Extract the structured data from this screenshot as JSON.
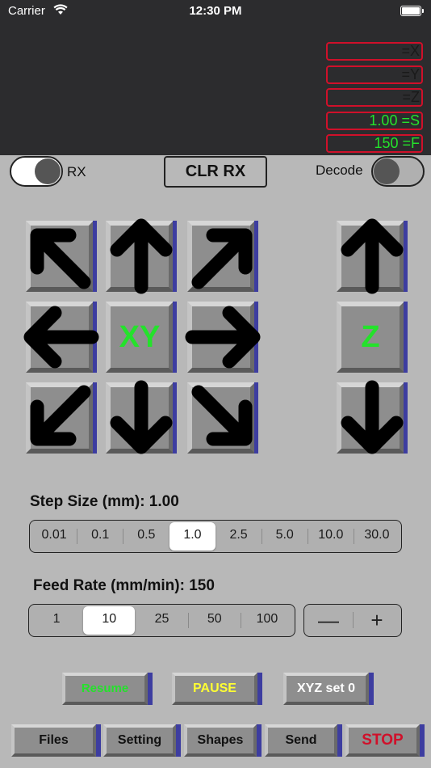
{
  "status_bar": {
    "carrier": "Carrier",
    "time": "12:30 PM"
  },
  "readouts": [
    {
      "value": "",
      "axis": "=X",
      "active": false
    },
    {
      "value": "",
      "axis": "=Y",
      "active": false
    },
    {
      "value": "",
      "axis": "=Z",
      "active": false
    },
    {
      "value": "1.00 ",
      "axis": "=S",
      "active": true
    },
    {
      "value": "150 ",
      "axis": "=F",
      "active": true
    }
  ],
  "controls": {
    "rx_label": "RX",
    "rx_on": true,
    "clear_button": "CLR RX",
    "decode_label": "Decode",
    "decode_on": false
  },
  "jog": {
    "xy_label": "XY",
    "z_label": "Z"
  },
  "step_size": {
    "title": "Step Size (mm): 1.00",
    "options": [
      "0.01",
      "0.1",
      "0.5",
      "1.0",
      "2.5",
      "5.0",
      "10.0",
      "30.0"
    ],
    "selected": "1.0"
  },
  "feed_rate": {
    "title": "Feed Rate (mm/min): 150",
    "options": [
      "1",
      "10",
      "25",
      "50",
      "100"
    ],
    "selected": "10",
    "minus": "—",
    "plus": "+"
  },
  "actions": {
    "resume": "Resume",
    "pause": "PAUSE",
    "xyz_set0": "XYZ set 0"
  },
  "toolbar": {
    "files": "Files",
    "setting": "Setting",
    "shapes": "Shapes",
    "send": "Send",
    "stop": "STOP"
  },
  "colors": {
    "accent_green": "#24e22b",
    "readout_border": "#d0102a",
    "button_edge": "#3d3da0",
    "pause_yellow": "#ffff33",
    "stop_red": "#d0102a"
  }
}
